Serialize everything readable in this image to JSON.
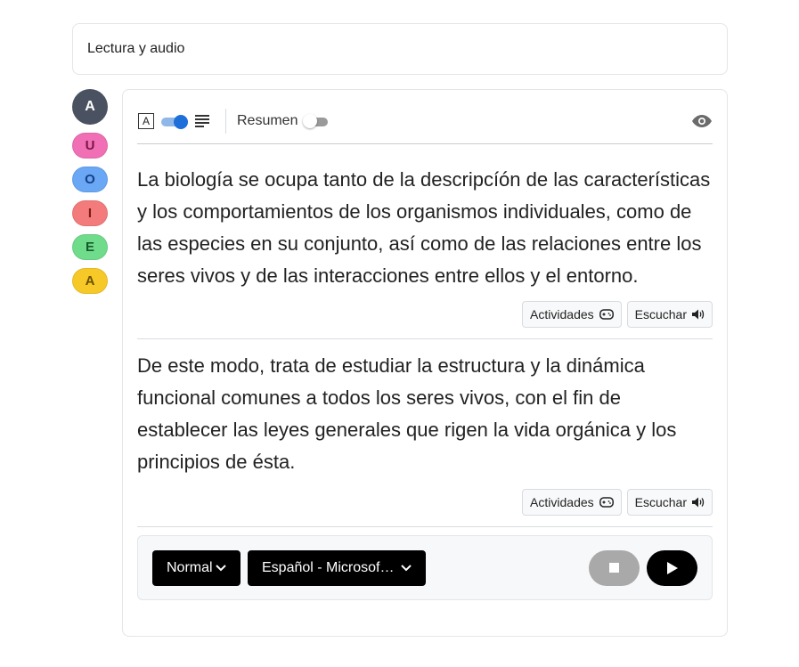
{
  "header": {
    "title": "Lectura y audio"
  },
  "sidebar": {
    "avatar_letter": "A",
    "vowels": [
      {
        "letter": "U",
        "bg": "#f06fb5",
        "fg": "#7a1745"
      },
      {
        "letter": "O",
        "bg": "#6aa7f5",
        "fg": "#163f84"
      },
      {
        "letter": "I",
        "bg": "#f37b7b",
        "fg": "#7d1b1b"
      },
      {
        "letter": "E",
        "bg": "#6fdc8c",
        "fg": "#155a2a"
      },
      {
        "letter": "A",
        "bg": "#f7c928",
        "fg": "#6b4f00"
      }
    ]
  },
  "toolbar": {
    "font_icon_letter": "A",
    "resumen_label": "Resumen",
    "accent_color": "#1e6fd9"
  },
  "paragraphs": [
    {
      "text": "La biología  se ocupa tanto de la descripcíón de las características y los comportamientos de los organismos individuales, como de las especies en su conjunto, así como de las relaciones entre los seres vivos y de las interacciones entre ellos y el entorno.",
      "actividades_label": "Actividades",
      "escuchar_label": "Escuchar"
    },
    {
      "text": "De este modo, trata de estudiar la estructura y la dinámica funcional comunes a todos los seres vivos, con el fin de establecer las leyes generales que rigen la vida orgánica y los principios de ésta.",
      "actividades_label": "Actividades",
      "escuchar_label": "Escuchar"
    }
  ],
  "player": {
    "speed_label": "Normal",
    "voice_label": "Español - Microsoft Helena"
  }
}
